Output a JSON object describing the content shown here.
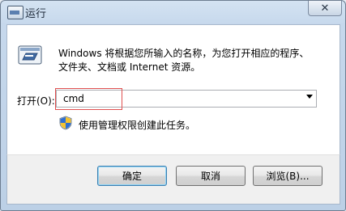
{
  "window": {
    "title": "运行",
    "close_glyph": "✕"
  },
  "icons": {
    "app": "run-app-icon",
    "run": "run-program-icon",
    "shield": "uac-shield-icon",
    "close": "close-icon",
    "dropdown": "chevron-down-icon"
  },
  "description": {
    "line1": "Windows 将根据您所输入的名称，为您打开相应的程序、",
    "line2": "文件夹、文档或 Internet 资源。"
  },
  "open_field": {
    "label": "打开(O):",
    "value": "cmd"
  },
  "admin_note": "使用管理权限创建此任务。",
  "buttons": {
    "ok": "确定",
    "cancel": "取消",
    "browse": "浏览(B)..."
  },
  "colors": {
    "highlight_border": "#e05050",
    "title_bar": "#c6d8ec",
    "default_button_border": "#3c7fb1"
  }
}
